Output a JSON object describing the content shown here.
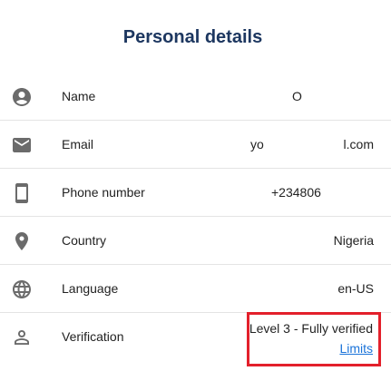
{
  "page": {
    "title": "Personal details"
  },
  "rows": [
    {
      "icon": "account-circle-icon",
      "label": "Name",
      "value": "O"
    },
    {
      "icon": "email-icon",
      "label": "Email",
      "value_part1": "yo",
      "value_part2": "l.com"
    },
    {
      "icon": "smartphone-icon",
      "label": "Phone number",
      "value": "+234806"
    },
    {
      "icon": "location-pin-icon",
      "label": "Country",
      "value": "Nigeria"
    },
    {
      "icon": "globe-icon",
      "label": "Language",
      "value": "en-US"
    },
    {
      "icon": "person-outline-icon",
      "label": "Verification",
      "value": "Level 3 - Fully verified",
      "link": "Limits"
    }
  ],
  "colors": {
    "title": "#1d3760",
    "highlight_border": "#e3202b",
    "link": "#1a73d9",
    "icon": "#6b6b6b"
  }
}
